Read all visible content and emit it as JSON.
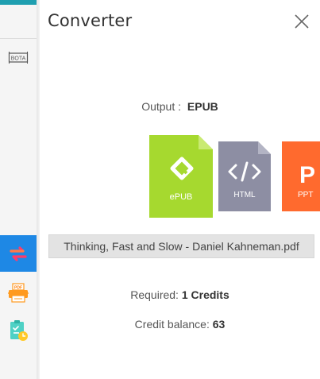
{
  "rail": {
    "items": [
      {
        "name": "bota-icon",
        "label": "BOTA"
      },
      {
        "name": "convert-icon"
      },
      {
        "name": "pdf-printer-icon",
        "label": "PDF"
      },
      {
        "name": "scheduled-task-icon"
      }
    ],
    "accent": "#1e88e5"
  },
  "panel": {
    "title": "Converter",
    "close_icon": "close-icon"
  },
  "output": {
    "label": "Output :",
    "value": "EPUB"
  },
  "formats": [
    {
      "name": "epub",
      "label": "ePUB",
      "color": "#a6d92f",
      "selected": true
    },
    {
      "name": "html",
      "label": "HTML",
      "color": "#8d8ea3",
      "selected": false
    },
    {
      "name": "ppt",
      "label": "PPT",
      "color": "#ff6a2e",
      "selected": false
    }
  ],
  "file": {
    "name": "Thinking, Fast and Slow - Daniel Kahneman.pdf"
  },
  "required": {
    "label": "Required:",
    "value": "1 Credits"
  },
  "balance": {
    "label": "Credit balance:",
    "value": "63"
  }
}
